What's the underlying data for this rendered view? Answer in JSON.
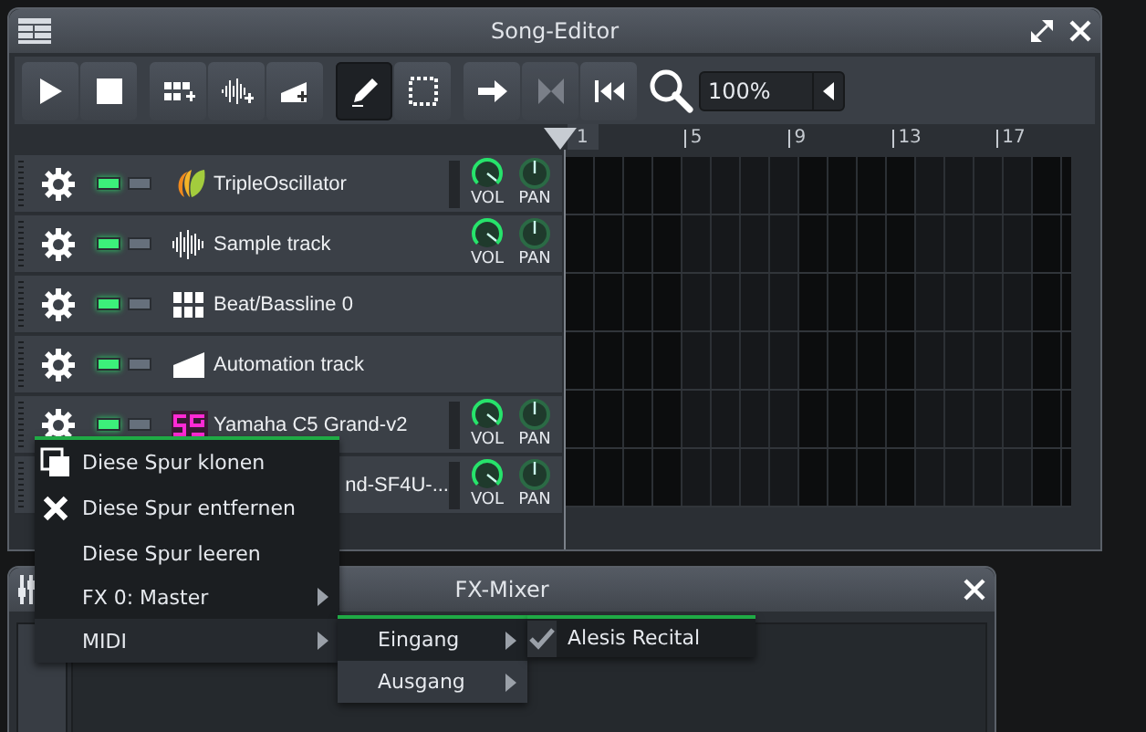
{
  "song_editor": {
    "title": "Song-Editor",
    "toolbar": [
      {
        "kind": "play",
        "selected": false,
        "disabled": false
      },
      {
        "kind": "stop",
        "selected": false,
        "disabled": false
      },
      {
        "kind": "add-beat",
        "selected": false,
        "disabled": false
      },
      {
        "kind": "add-sample",
        "selected": false,
        "disabled": false
      },
      {
        "kind": "add-automation",
        "selected": false,
        "disabled": false
      },
      {
        "kind": "draw",
        "selected": true,
        "disabled": false
      },
      {
        "kind": "select",
        "selected": false,
        "disabled": false
      },
      {
        "kind": "arrow",
        "selected": false,
        "disabled": false
      },
      {
        "kind": "bowtie",
        "selected": false,
        "disabled": true
      },
      {
        "kind": "rewind",
        "selected": false,
        "disabled": false
      }
    ],
    "zoom": {
      "value": "100%"
    },
    "ruler": [
      "1",
      "5",
      "9",
      "13",
      "17"
    ],
    "tracks": [
      {
        "kind": "triple",
        "name": "TripleOscillator",
        "muted": false,
        "solo": false,
        "meter": true,
        "knobs": [
          {
            "kind": "volume",
            "label": "VOL"
          },
          {
            "kind": "pan",
            "label": "PAN"
          }
        ]
      },
      {
        "kind": "sample",
        "name": "Sample track",
        "muted": false,
        "solo": false,
        "meter": false,
        "knobs": [
          {
            "kind": "volume",
            "label": "VOL"
          },
          {
            "kind": "pan",
            "label": "PAN"
          }
        ]
      },
      {
        "kind": "beat",
        "name": "Beat/Bassline 0",
        "muted": false,
        "solo": false,
        "meter": false
      },
      {
        "kind": "automation",
        "name": "Automation track",
        "muted": false,
        "solo": false,
        "meter": false
      },
      {
        "kind": "sf2",
        "name": "Yamaha C5 Grand-v2",
        "muted": false,
        "solo": false,
        "meter": true,
        "knobs": [
          {
            "kind": "volume",
            "label": "VOL"
          },
          {
            "kind": "pan",
            "label": "PAN"
          }
        ]
      },
      {
        "kind": "hidden",
        "name": "nd-SF4U-...",
        "meter": true,
        "knobs": [
          {
            "kind": "volume",
            "label": "VOL"
          },
          {
            "kind": "pan",
            "label": "PAN"
          }
        ]
      }
    ]
  },
  "fx_mixer": {
    "title": "FX-Mixer"
  },
  "context_menu": {
    "items": [
      {
        "kind": "clone",
        "label": "Diese Spur klonen",
        "submenu": false,
        "selected": false
      },
      {
        "kind": "remove",
        "label": "Diese Spur entfernen",
        "submenu": false,
        "selected": false
      },
      {
        "kind": "plain",
        "label": "Diese Spur leeren",
        "submenu": false,
        "selected": false
      },
      {
        "kind": "plain",
        "label": "FX 0: Master",
        "submenu": true,
        "selected": false
      },
      {
        "kind": "plain",
        "label": "MIDI",
        "submenu": true,
        "selected": true
      }
    ],
    "submenu": [
      {
        "label": "Eingang",
        "submenu": true,
        "selected": true
      },
      {
        "label": "Ausgang",
        "submenu": true,
        "selected": false
      }
    ],
    "devices": [
      {
        "label": "Alesis Recital",
        "checked": true
      }
    ]
  }
}
